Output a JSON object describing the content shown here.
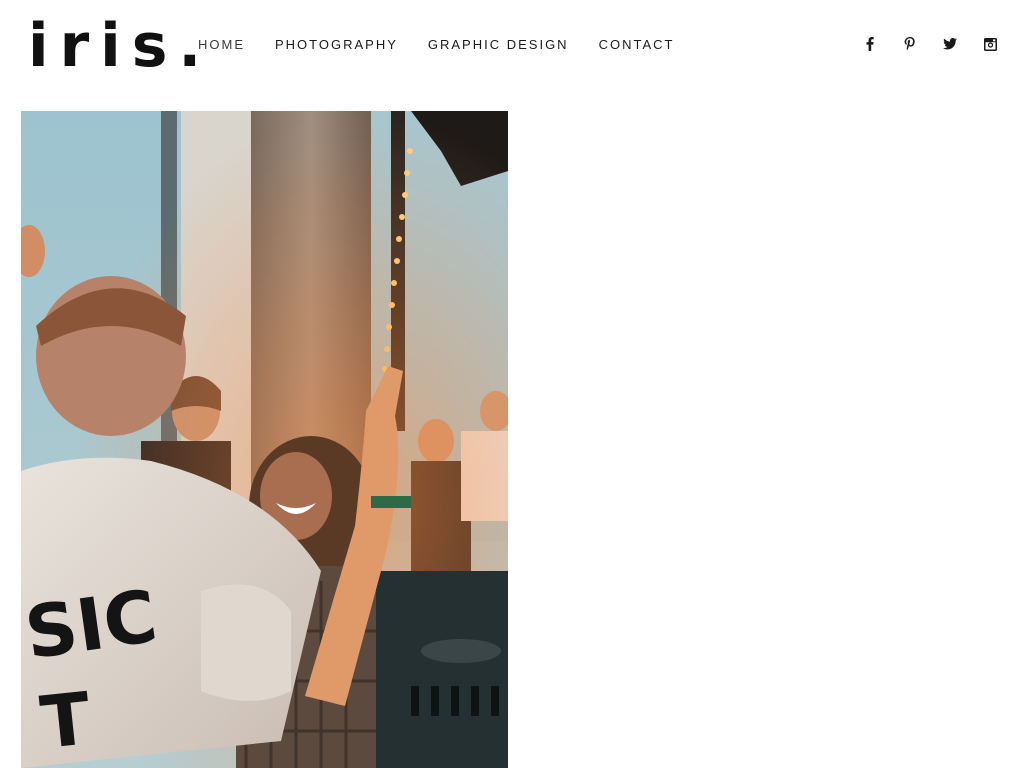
{
  "brand": {
    "logo_text": "iris."
  },
  "nav": {
    "items": [
      {
        "label": "HOME",
        "active": true
      },
      {
        "label": "PHOTOGRAPHY",
        "active": false
      },
      {
        "label": "GRAPHIC DESIGN",
        "active": false
      },
      {
        "label": "CONTACT",
        "active": false
      }
    ]
  },
  "social": {
    "icons": [
      "facebook-icon",
      "pinterest-icon",
      "twitter-icon",
      "instagram-icon"
    ]
  },
  "gallery": {
    "photo_description": "DJ party photo: man in white t-shirt with raised arm, smiling woman with curly hair, crowd by window with string lights, DJ mixer in foreground",
    "shirt_text_line1": "SIC",
    "shirt_text_line2": "T"
  },
  "colors": {
    "text": "#1a1a1a",
    "background": "#ffffff"
  }
}
